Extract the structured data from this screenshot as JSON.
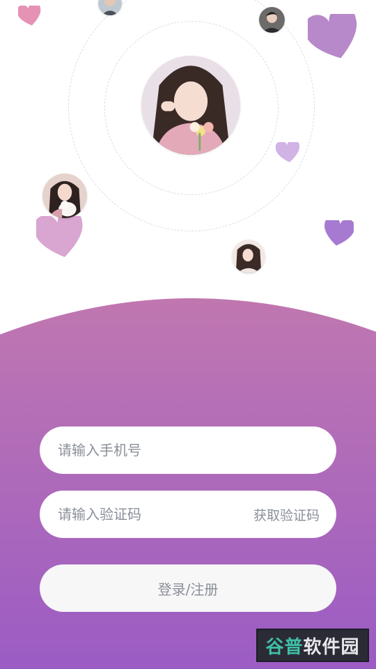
{
  "login": {
    "phone_placeholder": "请输入手机号",
    "code_placeholder": "请输入验证码",
    "get_code_label": "获取验证码",
    "submit_label": "登录/注册"
  },
  "watermark": {
    "part1": "谷普",
    "part2": "软件园"
  },
  "colors": {
    "panel_gradient_top": "#c077b0",
    "panel_gradient_bottom": "#9b5cc4",
    "heart_pink": "#d98ab8",
    "heart_purple": "#a979c9"
  }
}
